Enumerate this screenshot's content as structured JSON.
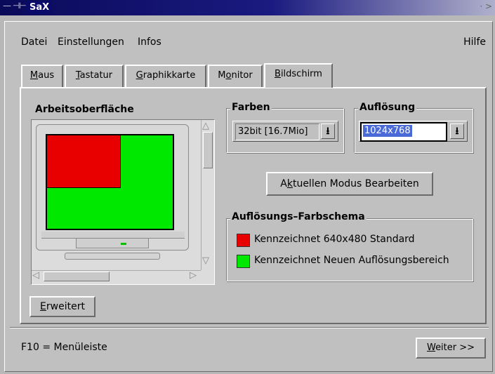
{
  "window": {
    "title": "SaX",
    "left_controls": "— ⊣⊢",
    "right_controls": "· >"
  },
  "menu": {
    "items": [
      "Datei",
      "Einstellungen",
      "Infos"
    ],
    "help": "Hilfe"
  },
  "tabs": [
    {
      "mnemonic": "M",
      "rest": "aus"
    },
    {
      "mnemonic": "T",
      "rest": "astatur"
    },
    {
      "mnemonic": "G",
      "rest": "raphikkarte"
    },
    {
      "prefix": "M",
      "mnemonic": "o",
      "rest": "nitor"
    },
    {
      "mnemonic": "B",
      "rest": "ildschirm",
      "active": true
    }
  ],
  "preview": {
    "title": "Arbeitsoberfläche",
    "colors": {
      "standard": "#e80000",
      "new_area": "#00e800"
    }
  },
  "farben": {
    "title": "Farben",
    "value": "32bit [16.7Mio]"
  },
  "aufloesung": {
    "title": "Auflösung",
    "value": "1024x768"
  },
  "modus_button": {
    "prefix": "A",
    "mnemonic": "k",
    "rest": "tuellen Modus Bearbeiten"
  },
  "schema": {
    "title": "Auflösungs–Farbschema",
    "items": [
      {
        "label": "Kennzeichnet 640x480 Standard",
        "color": "#e80000"
      },
      {
        "label": "Kennzeichnet Neuen Auflösungsbereich",
        "color": "#00e800"
      }
    ]
  },
  "erweitert_button": {
    "mnemonic": "E",
    "rest": "rweitert"
  },
  "status": {
    "text": "F10 = Menüleiste",
    "next_button": {
      "mnemonic": "W",
      "rest": "eiter >>"
    }
  }
}
